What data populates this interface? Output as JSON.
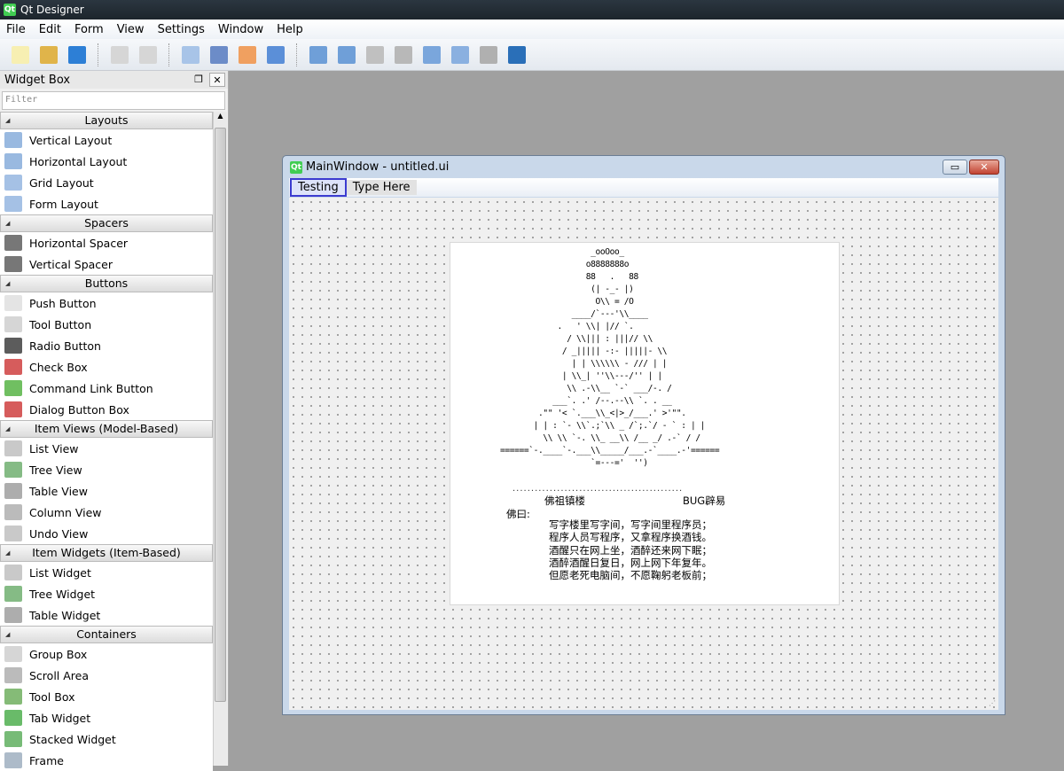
{
  "app": {
    "title": "Qt Designer",
    "icon": "qt-logo"
  },
  "menu": [
    "File",
    "Edit",
    "Form",
    "View",
    "Settings",
    "Window",
    "Help"
  ],
  "toolbar": [
    {
      "name": "new-icon",
      "color": "#f7efb2"
    },
    {
      "name": "open-icon",
      "color": "#e0b44a"
    },
    {
      "name": "save-icon",
      "color": "#2d7fd6"
    },
    {
      "sep": true
    },
    {
      "name": "bring-front-icon",
      "color": "#d6d6d6"
    },
    {
      "name": "send-back-icon",
      "color": "#d6d6d6"
    },
    {
      "sep": true
    },
    {
      "name": "edit-widgets-icon",
      "color": "#a8c4e8"
    },
    {
      "name": "edit-signals-icon",
      "color": "#6c8cc8"
    },
    {
      "name": "edit-buddies-icon",
      "color": "#f0a060"
    },
    {
      "name": "edit-tab-order-icon",
      "color": "#5b8fd8"
    },
    {
      "sep": true
    },
    {
      "name": "layout-horizontal-icon",
      "color": "#6f9fd8"
    },
    {
      "name": "layout-vertical-icon",
      "color": "#6f9fd8"
    },
    {
      "name": "splitter-horizontal-icon",
      "color": "#c0c0c0"
    },
    {
      "name": "splitter-vertical-icon",
      "color": "#b8b8b8"
    },
    {
      "name": "layout-grid-icon",
      "color": "#7aa6dc"
    },
    {
      "name": "layout-form-icon",
      "color": "#8ab0e0"
    },
    {
      "name": "break-layout-icon",
      "color": "#b0b0b0"
    },
    {
      "name": "adjust-size-icon",
      "color": "#2a6fb8"
    }
  ],
  "widget_box": {
    "title": "Widget Box",
    "filter_placeholder": "Filter",
    "groups": [
      {
        "label": "Layouts",
        "items": [
          [
            "Vertical Layout",
            "#7fa8d8"
          ],
          [
            "Horizontal Layout",
            "#7fa8d8"
          ],
          [
            "Grid Layout",
            "#8fb2de"
          ],
          [
            "Form Layout",
            "#8fb2de"
          ]
        ]
      },
      {
        "label": "Spacers",
        "items": [
          [
            "Horizontal Spacer",
            "#555"
          ],
          [
            "Vertical Spacer",
            "#555"
          ]
        ]
      },
      {
        "label": "Buttons",
        "items": [
          [
            "Push Button",
            "#ddd"
          ],
          [
            "Tool Button",
            "#ccc"
          ],
          [
            "Radio Button",
            "#333"
          ],
          [
            "Check Box",
            "#c33"
          ],
          [
            "Command Link Button",
            "#4caf3a"
          ],
          [
            "Dialog Button Box",
            "#c33"
          ]
        ]
      },
      {
        "label": "Item Views (Model-Based)",
        "items": [
          [
            "List View",
            "#bbb"
          ],
          [
            "Tree View",
            "#6a6"
          ],
          [
            "Table View",
            "#999"
          ],
          [
            "Column View",
            "#aaa"
          ],
          [
            "Undo View",
            "#bbb"
          ]
        ]
      },
      {
        "label": "Item Widgets (Item-Based)",
        "items": [
          [
            "List Widget",
            "#bbb"
          ],
          [
            "Tree Widget",
            "#6a6"
          ],
          [
            "Table Widget",
            "#999"
          ]
        ]
      },
      {
        "label": "Containers",
        "items": [
          [
            "Group Box",
            "#ccc"
          ],
          [
            "Scroll Area",
            "#aaa"
          ],
          [
            "Tool Box",
            "#6a5"
          ],
          [
            "Tab Widget",
            "#4a4"
          ],
          [
            "Stacked Widget",
            "#5a5"
          ],
          [
            "Frame",
            "#9ab"
          ]
        ]
      }
    ]
  },
  "form_window": {
    "title": "MainWindow - untitled.ui",
    "menus": [
      "Testing",
      "Type Here"
    ],
    "buttons": {
      "minimize": "▭",
      "close": "✕"
    },
    "label": {
      "ascii_art": "                   _ooOoo_\n                  o8888888o\n                  88   .   88\n                   (| -_- |)\n                    O\\\\ = /O\n               ____/`---'\\\\____\n            .   ' \\\\| |// `.\n              / \\\\||| : |||// \\\\\n             / _||||| -:- |||||- \\\\\n               | | \\\\\\\\\\\\ - /// | |\n             | \\\\_| ''\\\\---/'' | |\n              \\\\ .-\\\\__ `-` ___/-. /\n           ___`. .' /--.--\\\\ `. . __\n        .\"\" '< `.___\\\\_<|>_/___.' >'\"\".\n       | | : `- \\\\`.;`\\\\ _ /`;.`/ - ` : | |\n         \\\\ \\\\ `-. \\\\_ __\\\\ /__ _/ .-` / /\n======`-.____`-.___\\\\_____/___.-`____.-'======\n                   `=---='  '')",
      "dots": "..............................................",
      "left_caption": "佛祖镇楼",
      "right_caption": "BUG辟易",
      "speaker": "佛曰:",
      "poem": [
        "写字楼里写字间，写字间里程序员；",
        "程序人员写程序，又拿程序换酒钱。",
        "酒醒只在网上坐，酒醉还来网下眠；",
        "酒醉酒醒日复日，网上网下年复年。",
        "但愿老死电脑间，不愿鞠躬老板前；"
      ]
    }
  }
}
